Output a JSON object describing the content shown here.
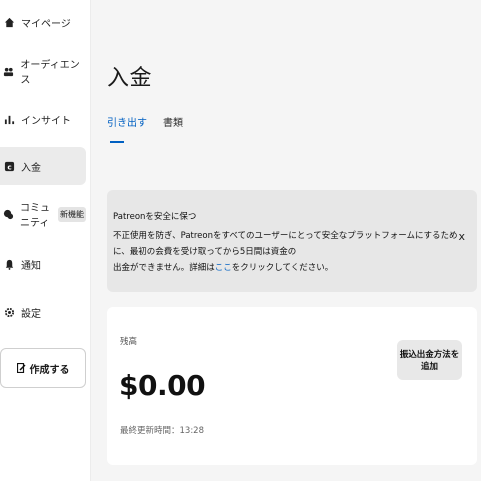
{
  "sidebar": {
    "items": [
      {
        "label": "マイページ",
        "icon": "home-icon"
      },
      {
        "label": "オーディエンス",
        "icon": "people-icon"
      },
      {
        "label": "インサイト",
        "icon": "bar-chart-icon"
      },
      {
        "label": "入金",
        "icon": "payout-icon",
        "active": true
      },
      {
        "label": "コミュニティ",
        "icon": "community-icon",
        "badge": "新機能"
      },
      {
        "label": "通知",
        "icon": "bell-icon"
      },
      {
        "label": "設定",
        "icon": "gear-icon"
      }
    ],
    "create_label": "作成する"
  },
  "main": {
    "title": "入金",
    "tabs": [
      {
        "label": "引き出す",
        "active": true
      },
      {
        "label": "書類",
        "active": false
      }
    ],
    "notice": {
      "title": "Patreonを安全に保つ",
      "body_line1": "不正使用を防ぎ、Patreonをすべてのユーザーにとって安全なプラットフォームにするために、最初の会費を受け取ってから5日間は資金の",
      "body_line2_prefix": "出金ができません。詳細は",
      "link_text": "ここ",
      "body_line2_suffix": "をクリックしてください。",
      "close_label": "x"
    },
    "balance": {
      "label": "残高",
      "amount": "$0.00",
      "updated": "最終更新時間：13:28",
      "add_method_label": "振込出金方法を追加"
    }
  },
  "colors": {
    "accent": "#0060c2",
    "background": "#f5f5f5",
    "sidebar": "#ffffff",
    "notice_bg": "#e7e7e7"
  }
}
